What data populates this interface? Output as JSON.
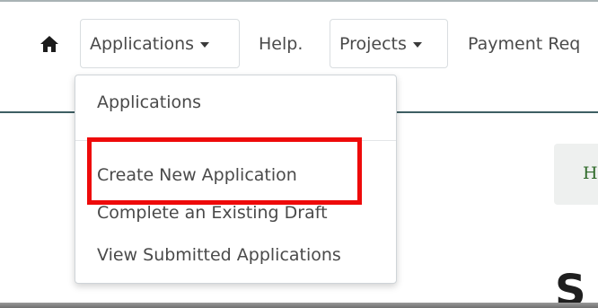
{
  "nav": {
    "home_icon": "home-icon",
    "applications_label": "Applications",
    "help_label": "Help.",
    "projects_label": "Projects",
    "payment_label": "Payment Req"
  },
  "dropdown": {
    "items": [
      "Applications",
      "Create New Application",
      "Complete an Existing Draft",
      "View Submitted Applications"
    ]
  },
  "side_card": {
    "text": "H"
  },
  "heading_partial": "S",
  "colors": {
    "highlight": "#ee0a0a",
    "header_line": "#3e5f63",
    "link_green": "#2f6a2a"
  }
}
